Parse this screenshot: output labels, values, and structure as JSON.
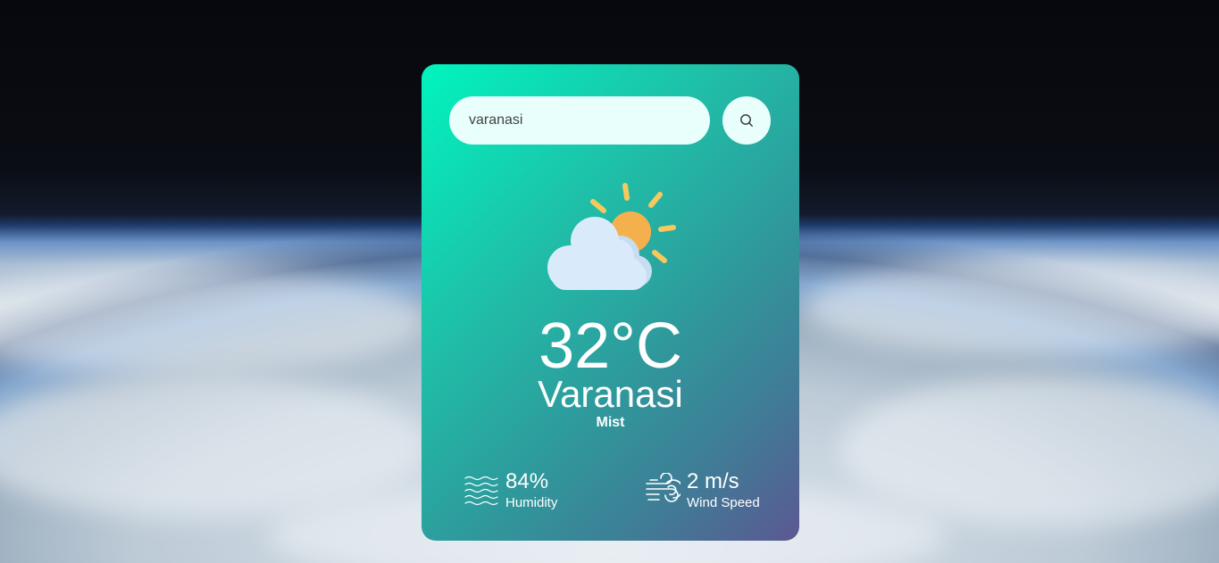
{
  "search": {
    "value": "varanasi",
    "placeholder": ""
  },
  "weather": {
    "icon": "partly-cloudy-icon",
    "temperature": "32°C",
    "city": "Varanasi",
    "condition": "Mist"
  },
  "details": {
    "humidity": {
      "icon": "humidity-waves-icon",
      "value": "84%",
      "label": "Humidity"
    },
    "wind": {
      "icon": "wind-icon",
      "value": "2 m/s",
      "label": "Wind Speed"
    }
  },
  "colors": {
    "card_gradient_start": "#00f5be",
    "card_gradient_end": "#5b5892",
    "input_bg": "#e8fffb",
    "sun": "#f5b04e",
    "sun_rays": "#f7c95c",
    "cloud": "#d9ebfa"
  }
}
